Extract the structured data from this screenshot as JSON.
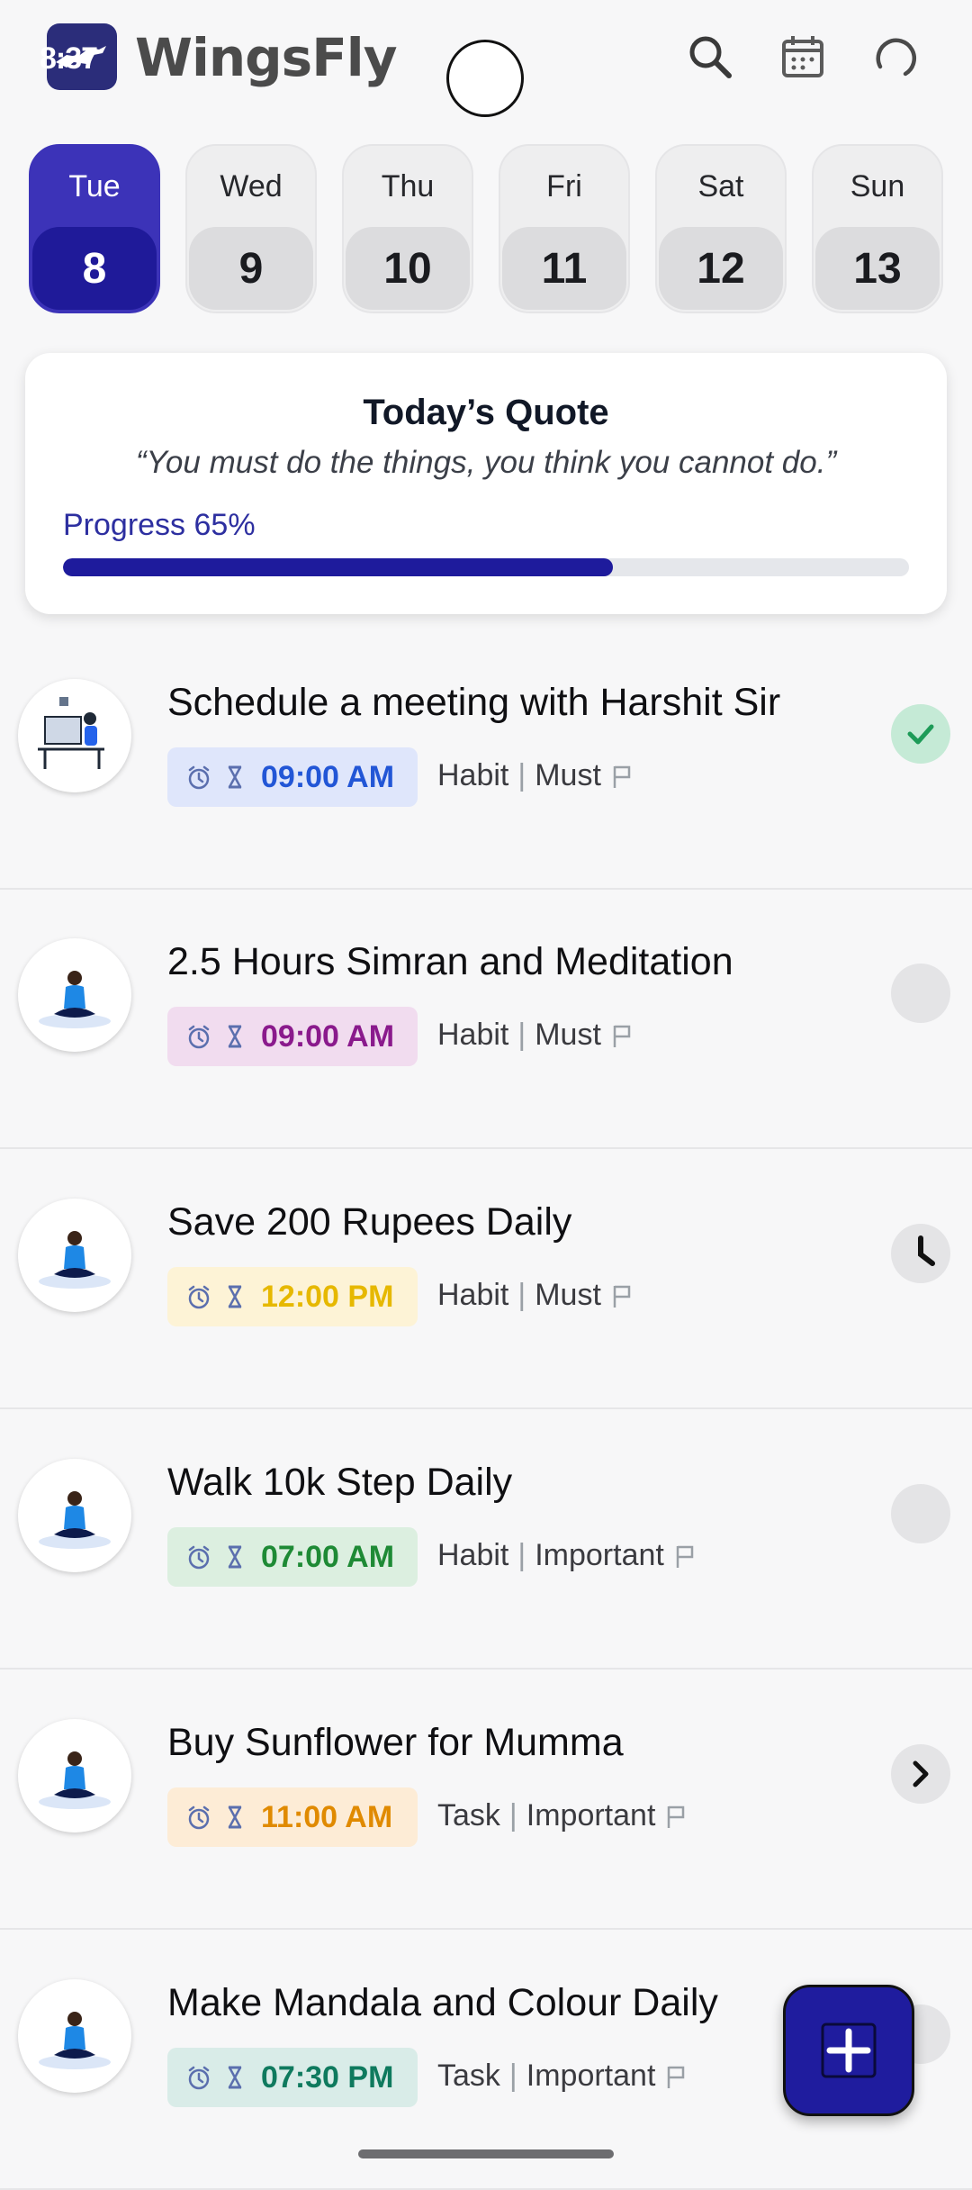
{
  "status": {
    "time": "8:37"
  },
  "app": {
    "name": "WingsFly"
  },
  "header": {
    "icons": [
      "search-icon",
      "calendar-icon",
      "profile-ring-icon"
    ]
  },
  "days": [
    {
      "name": "Tue",
      "num": "8",
      "active": true
    },
    {
      "name": "Wed",
      "num": "9"
    },
    {
      "name": "Thu",
      "num": "10"
    },
    {
      "name": "Fri",
      "num": "11"
    },
    {
      "name": "Sat",
      "num": "12"
    },
    {
      "name": "Sun",
      "num": "13"
    }
  ],
  "quote": {
    "title": "Today’s Quote",
    "text": "“You must do the things, you think you cannot do.”",
    "progress_label": "Progress 65%",
    "progress_value": 0.65
  },
  "tasks": [
    {
      "title": "Schedule a meeting with Harshit Sir",
      "time": "09:00 AM",
      "type": "Habit",
      "priority": "Must",
      "status": "done",
      "chip_bg": "#dfe6fb",
      "chip_color": "#2256d6"
    },
    {
      "title": "2.5 Hours Simran and Meditation",
      "time": "09:00 AM",
      "type": "Habit",
      "priority": "Must",
      "status": "empty",
      "chip_bg": "#f1dcef",
      "chip_color": "#8a1a8c"
    },
    {
      "title": "Save 200 Rupees Daily",
      "time": "12:00 PM",
      "type": "Habit",
      "priority": "Must",
      "status": "pending",
      "chip_bg": "#fdf3d6",
      "chip_color": "#e6b800"
    },
    {
      "title": "Walk 10k Step Daily",
      "time": "07:00 AM",
      "type": "Habit",
      "priority": "Important",
      "status": "empty",
      "chip_bg": "#dcefe0",
      "chip_color": "#1e8a35"
    },
    {
      "title": "Buy Sunflower for Mumma",
      "time": "11:00 AM",
      "type": "Task",
      "priority": "Important",
      "status": "arrow",
      "chip_bg": "#fdecd6",
      "chip_color": "#e08a00"
    },
    {
      "title": "Make Mandala and Colour Daily",
      "time": "07:30 PM",
      "type": "Task",
      "priority": "Important",
      "status": "empty",
      "chip_bg": "#d9ece8",
      "chip_color": "#0f7a5e"
    }
  ],
  "fab": {
    "icon": "plus-icon"
  }
}
